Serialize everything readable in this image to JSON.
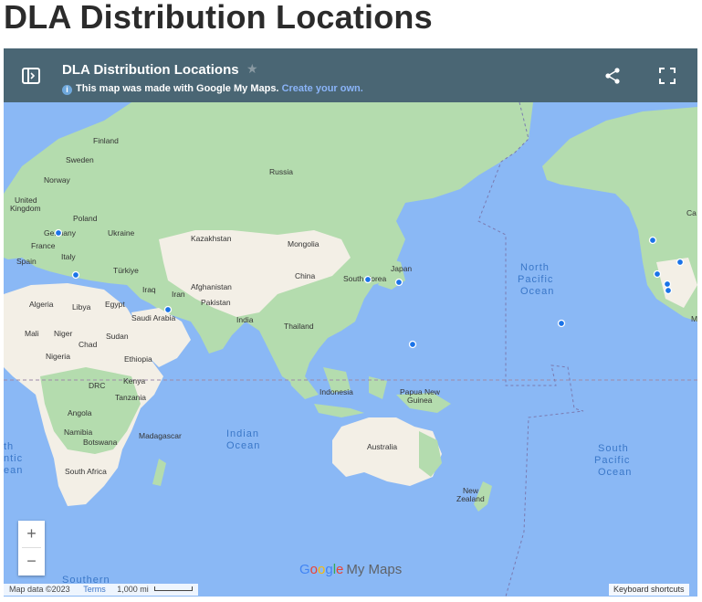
{
  "page": {
    "title": "DLA Distribution Locations"
  },
  "topbar": {
    "title": "DLA Distribution Locations",
    "notice_text": "This map was made with Google My Maps.",
    "notice_link": "Create your own."
  },
  "map": {
    "labels": {
      "finland": "Finland",
      "sweden": "Sweden",
      "norway": "Norway",
      "united_kingdom_1": "United",
      "united_kingdom_2": "Kingdom",
      "poland": "Poland",
      "germany": "Germany",
      "ukraine": "Ukraine",
      "france": "France",
      "italy": "Italy",
      "spain": "Spain",
      "turkiye": "Türkiye",
      "kazakhstan": "Kazakhstan",
      "mongolia": "Mongolia",
      "russia": "Russia",
      "china": "China",
      "iraq": "Iraq",
      "iran": "Iran",
      "afghanistan": "Afghanistan",
      "pakistan": "Pakistan",
      "india": "India",
      "saudi_arabia": "Saudi Arabia",
      "egypt": "Egypt",
      "libya": "Libya",
      "algeria": "Algeria",
      "mali": "Mali",
      "niger": "Niger",
      "chad": "Chad",
      "sudan": "Sudan",
      "nigeria": "Nigeria",
      "ethiopia": "Ethiopia",
      "kenya": "Kenya",
      "drc": "DRC",
      "tanzania": "Tanzania",
      "angola": "Angola",
      "namibia": "Namibia",
      "botswana": "Botswana",
      "madagascar": "Madagascar",
      "south_africa": "South Africa",
      "thailand": "Thailand",
      "south_korea": "South Korea",
      "japan": "Japan",
      "indonesia": "Indonesia",
      "papua_new_guinea_1": "Papua New",
      "papua_new_guinea_2": "Guinea",
      "australia": "Australia",
      "new_zealand_1": "New",
      "new_zealand_2": "Zealand",
      "ca": "Ca",
      "me": "Me"
    },
    "oceans": {
      "north_pacific": [
        "North",
        "Pacific",
        "Ocean"
      ],
      "south_pacific": [
        "South",
        "Pacific",
        "Ocean"
      ],
      "indian": [
        "Indian",
        "Ocean"
      ],
      "south_atlantic": [
        "th",
        "ntic",
        "ean"
      ],
      "southern": "Southern"
    },
    "marker_color": "#1a73e8",
    "land_color": "#b4dcae",
    "desert_color": "#f3efe6",
    "water_color": "#8ab8f5"
  },
  "controls": {
    "zoom_in": "+",
    "zoom_out": "−"
  },
  "attribution": {
    "map_data": "Map data ©2023",
    "terms": "Terms",
    "scale": "1,000 mi",
    "keyboard": "Keyboard shortcuts",
    "logo_google": [
      "G",
      "o",
      "o",
      "g",
      "l",
      "e"
    ],
    "logo_mymaps": "My Maps"
  }
}
